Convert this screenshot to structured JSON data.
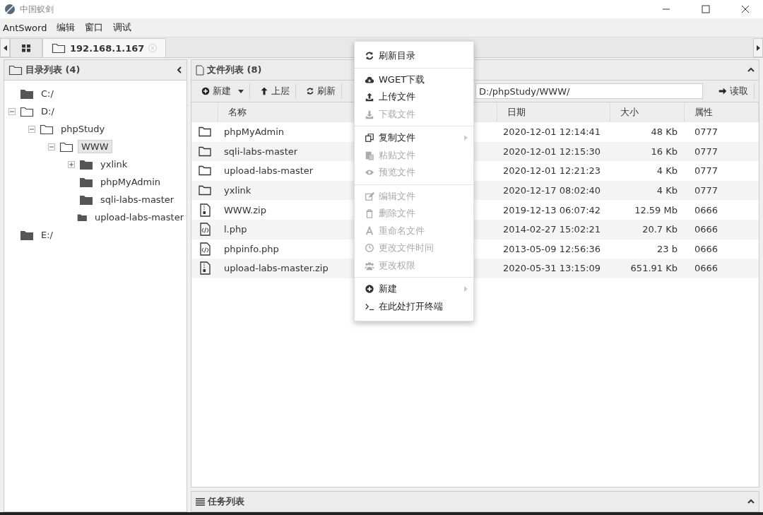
{
  "window": {
    "title": "中国蚁剑"
  },
  "menu_bar": [
    "AntSword",
    "编辑",
    "窗口",
    "调试"
  ],
  "tabs": [
    {
      "kind": "grid",
      "selected": false
    },
    {
      "kind": "host",
      "label": "192.168.1.167",
      "selected": true
    }
  ],
  "directory_panel": {
    "title": "目录列表 (4)",
    "tree": [
      {
        "label": "C:/",
        "expandable": false,
        "expanded": false,
        "selected": false
      },
      {
        "label": "D:/",
        "expandable": true,
        "expanded": true,
        "selected": false,
        "children": [
          {
            "label": "phpStudy",
            "expandable": true,
            "expanded": true,
            "selected": false,
            "children": [
              {
                "label": "WWW",
                "expandable": true,
                "expanded": true,
                "selected": true,
                "children": [
                  {
                    "label": "yxlink",
                    "expandable": true,
                    "expanded": false,
                    "selected": false
                  },
                  {
                    "label": "phpMyAdmin",
                    "expandable": false,
                    "expanded": false,
                    "selected": false
                  },
                  {
                    "label": "sqli-labs-master",
                    "expandable": false,
                    "expanded": false,
                    "selected": false
                  },
                  {
                    "label": "upload-labs-master",
                    "expandable": false,
                    "expanded": false,
                    "selected": false
                  }
                ]
              }
            ]
          }
        ]
      },
      {
        "label": "E:/",
        "expandable": false,
        "expanded": false,
        "selected": false
      }
    ]
  },
  "file_panel": {
    "title": "文件列表 (8)",
    "toolbar": [
      "新建",
      "上层",
      "刷新"
    ],
    "path": "D:/phpStudy/WWW/",
    "read_button": "读取",
    "columns": [
      "名称",
      "日期",
      "大小",
      "属性"
    ],
    "rows": [
      {
        "kind": "folder",
        "name": "phpMyAdmin",
        "date": "2020-12-01 12:14:41",
        "size": "48 Kb",
        "attr": "0777"
      },
      {
        "kind": "folder",
        "name": "sqli-labs-master",
        "date": "2020-12-01 12:15:30",
        "size": "16 Kb",
        "attr": "0777"
      },
      {
        "kind": "folder",
        "name": "upload-labs-master",
        "date": "2020-12-01 12:21:23",
        "size": "4 Kb",
        "attr": "0777"
      },
      {
        "kind": "folder",
        "name": "yxlink",
        "date": "2020-12-17 08:02:40",
        "size": "4 Kb",
        "attr": "0777"
      },
      {
        "kind": "zip",
        "name": "WWW.zip",
        "date": "2019-12-13 06:07:42",
        "size": "12.59 Mb",
        "attr": "0666"
      },
      {
        "kind": "code",
        "name": "l.php",
        "date": "2014-02-27 15:02:21",
        "size": "20.7 Kb",
        "attr": "0666"
      },
      {
        "kind": "code",
        "name": "phpinfo.php",
        "date": "2013-05-09 12:56:36",
        "size": "23 b",
        "attr": "0666"
      },
      {
        "kind": "zip",
        "name": "upload-labs-master.zip",
        "date": "2020-05-31 13:15:09",
        "size": "651.91 Kb",
        "attr": "0666"
      }
    ]
  },
  "task_panel": {
    "title": "任务列表"
  },
  "context_menu": {
    "groups": [
      [
        {
          "label": "刷新目录",
          "disabled": false,
          "submenu": false
        }
      ],
      [
        {
          "label": "WGET下载",
          "disabled": false,
          "submenu": false
        },
        {
          "label": "上传文件",
          "disabled": false,
          "submenu": false
        },
        {
          "label": "下载文件",
          "disabled": true,
          "submenu": false
        }
      ],
      [
        {
          "label": "复制文件",
          "disabled": false,
          "submenu": true
        },
        {
          "label": "粘贴文件",
          "disabled": true,
          "submenu": false
        },
        {
          "label": "预览文件",
          "disabled": true,
          "submenu": false
        }
      ],
      [
        {
          "label": "编辑文件",
          "disabled": true,
          "submenu": false
        },
        {
          "label": "删除文件",
          "disabled": true,
          "submenu": false
        },
        {
          "label": "重命名文件",
          "disabled": true,
          "submenu": false
        },
        {
          "label": "更改文件时间",
          "disabled": true,
          "submenu": false
        },
        {
          "label": "更改权限",
          "disabled": true,
          "submenu": false
        }
      ],
      [
        {
          "label": "新建",
          "disabled": false,
          "submenu": true
        },
        {
          "label": "在此处打开终端",
          "disabled": false,
          "submenu": false
        }
      ]
    ]
  }
}
